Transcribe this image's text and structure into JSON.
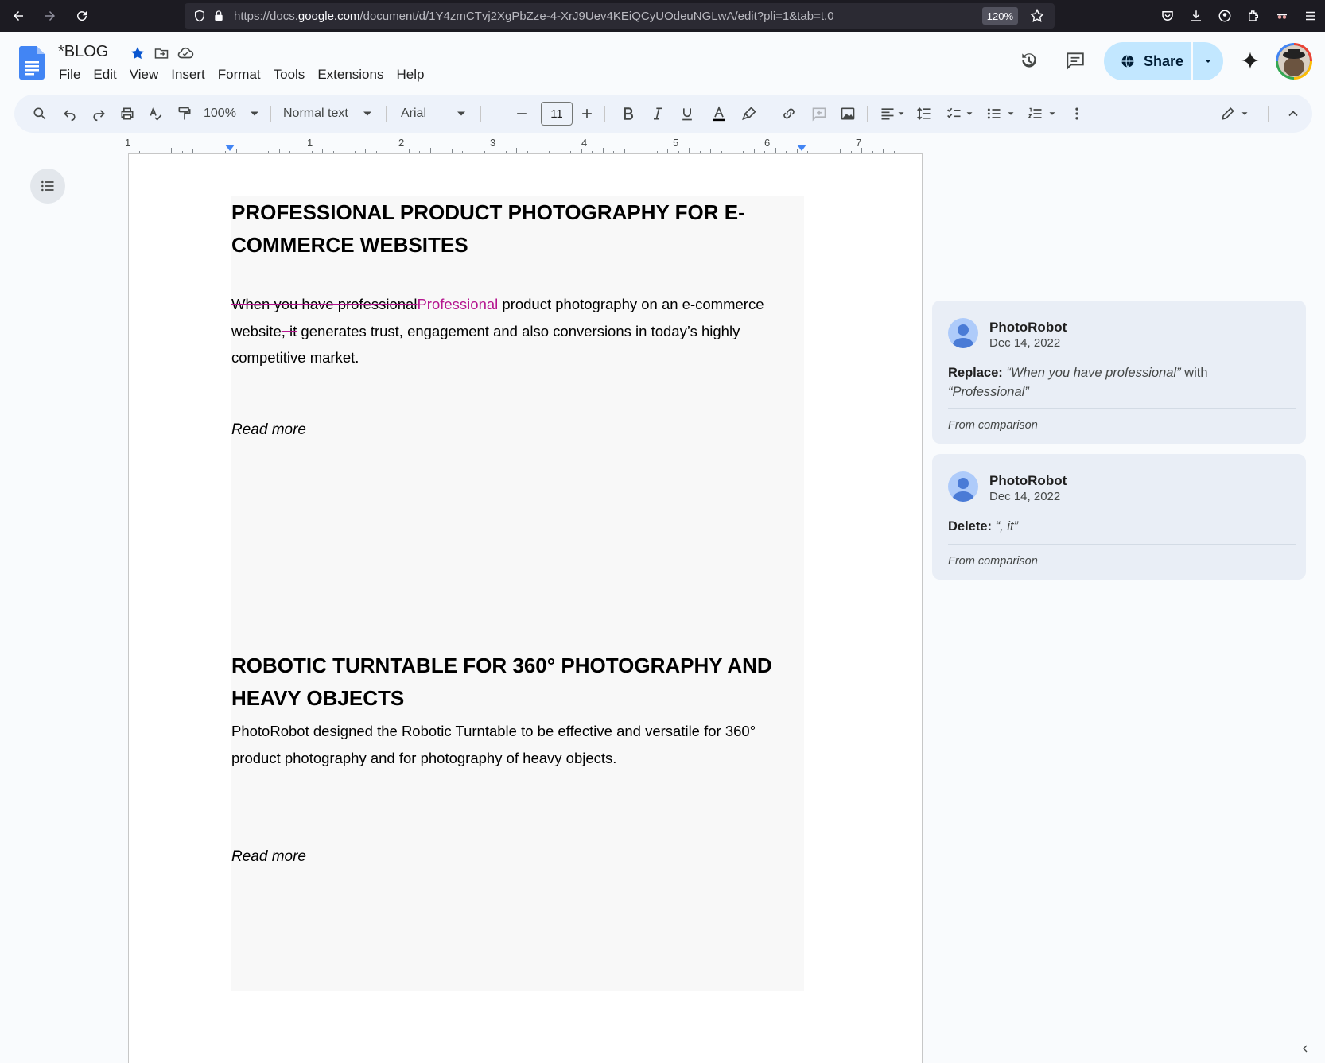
{
  "browser": {
    "url_prefix": "https://docs.",
    "url_host": "google.com",
    "url_path": "/document/d/1Y4zmCTvj2XgPbZze-4-XrJ9Uev4KEiQCyUOdeuNGLwA/edit?pli=1&tab=t.0",
    "zoom": "120%"
  },
  "header": {
    "title": "*BLOG",
    "menu": [
      "File",
      "Edit",
      "View",
      "Insert",
      "Format",
      "Tools",
      "Extensions",
      "Help"
    ],
    "share_label": "Share"
  },
  "toolbar": {
    "zoom": "100%",
    "style": "Normal text",
    "font": "Arial",
    "font_size": "11"
  },
  "ruler": {
    "labels": [
      "1",
      "1",
      "2",
      "3",
      "4",
      "5",
      "6",
      "7"
    ]
  },
  "document": {
    "heading1": "PROFESSIONAL PRODUCT PHOTOGRAPHY FOR E-COMMERCE WEBSITES",
    "para1_deleted": "When you have professional",
    "para1_inserted": "Professional",
    "para1_a": " product photography on an e-commerce website",
    "para1_deleted2": ", it",
    "para1_b": " generates trust, engagement and also conversions  in today’s highly competitive market.",
    "readmore1": "Read more",
    "heading2": "ROBOTIC TURNTABLE FOR 360° PHOTOGRAPHY AND HEAVY OBJECTS",
    "para2": "PhotoRobot designed the Robotic Turntable to be effective and versatile for 360° product photography and for photography of heavy objects.",
    "readmore2": "Read more"
  },
  "comments": [
    {
      "author": "PhotoRobot",
      "date": "Dec 14, 2022",
      "action": "Replace:",
      "old": "“When you have professional”",
      "with": " with ",
      "new": "“Professional”",
      "footer": "From comparison"
    },
    {
      "author": "PhotoRobot",
      "date": "Dec 14, 2022",
      "action": "Delete:",
      "old": "“, it”",
      "footer": "From comparison"
    }
  ],
  "colors": {
    "suggestion": "#b5158f",
    "share_bg": "#c2e7ff",
    "docs_blue": "#4285f4"
  }
}
